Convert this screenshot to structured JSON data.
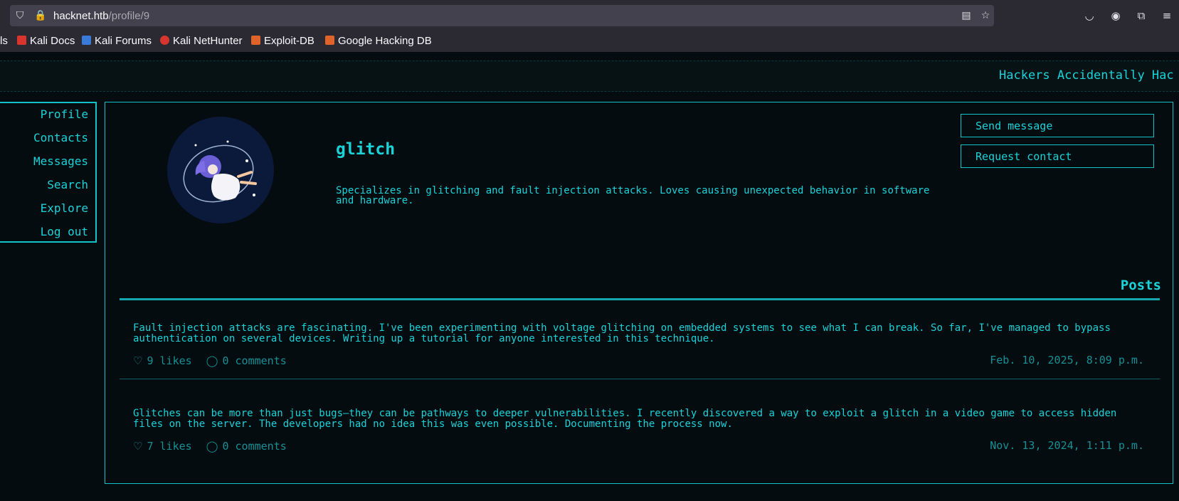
{
  "browser": {
    "url_host": "hacknet.htb",
    "url_path": "/profile/9",
    "bookmarks": [
      {
        "label": "ls",
        "color": "transparent"
      },
      {
        "label": "Kali Docs",
        "color": "#d9352f"
      },
      {
        "label": "Kali Forums",
        "color": "#3a7ad9"
      },
      {
        "label": "Kali NetHunter",
        "color": "#d9352f"
      },
      {
        "label": "Exploit-DB",
        "color": "#e0642a"
      },
      {
        "label": "Google Hacking DB",
        "color": "#e0642a"
      }
    ]
  },
  "site": {
    "banner": "Hackers Accidentally Hac",
    "nav": [
      "Profile",
      "Contacts",
      "Messages",
      "Search",
      "Explore",
      "Log out"
    ]
  },
  "profile": {
    "username": "glitch",
    "bio": "Specializes in glitching and fault injection attacks. Loves causing unexpected behavior in software and hardware.",
    "send_message_label": "Send message",
    "request_contact_label": "Request contact",
    "posts_heading": "Posts"
  },
  "posts": [
    {
      "text": "Fault injection attacks are fascinating. I've been experimenting with voltage glitching on embedded systems to see what I can break. So far, I've managed to bypass authentication on several devices. Writing up a tutorial for anyone interested in this technique.",
      "likes": "9 likes",
      "comments": "0 comments",
      "date": "Feb. 10, 2025, 8:09 p.m."
    },
    {
      "text": "Glitches can be more than just bugs—they can be pathways to deeper vulnerabilities. I recently discovered a way to exploit a glitch in a video game to access hidden files on the server. The developers had no idea this was even possible. Documenting the process now.",
      "likes": "7 likes",
      "comments": "0 comments",
      "date": "Nov. 13, 2024, 1:11 p.m."
    }
  ],
  "colors": {
    "accent": "#19d3d9",
    "background": "#050c0f",
    "muted": "#159096"
  },
  "icons": [
    "shield-icon",
    "lock-icon",
    "reader-icon",
    "star-icon",
    "pocket-icon",
    "account-icon",
    "extensions-icon",
    "menu-icon",
    "heart-icon",
    "comment-icon"
  ]
}
